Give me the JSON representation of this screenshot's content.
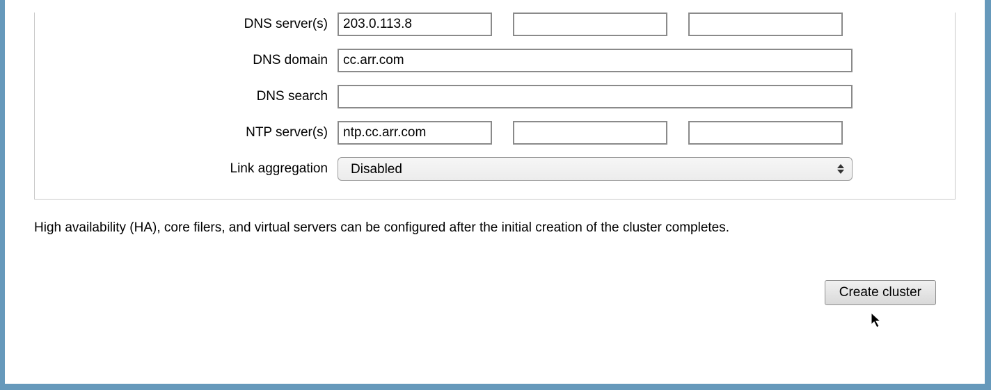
{
  "form": {
    "dns_servers": {
      "label": "DNS server(s)",
      "values": [
        "203.0.113.8",
        "",
        ""
      ]
    },
    "dns_domain": {
      "label": "DNS domain",
      "value": "cc.arr.com"
    },
    "dns_search": {
      "label": "DNS search",
      "value": ""
    },
    "ntp_servers": {
      "label": "NTP server(s)",
      "values": [
        "ntp.cc.arr.com",
        "",
        ""
      ]
    },
    "link_aggregation": {
      "label": "Link aggregation",
      "selected": "Disabled"
    }
  },
  "note": "High availability (HA), core filers, and virtual servers can be configured after the initial creation of the cluster completes.",
  "actions": {
    "create_cluster": "Create cluster"
  }
}
